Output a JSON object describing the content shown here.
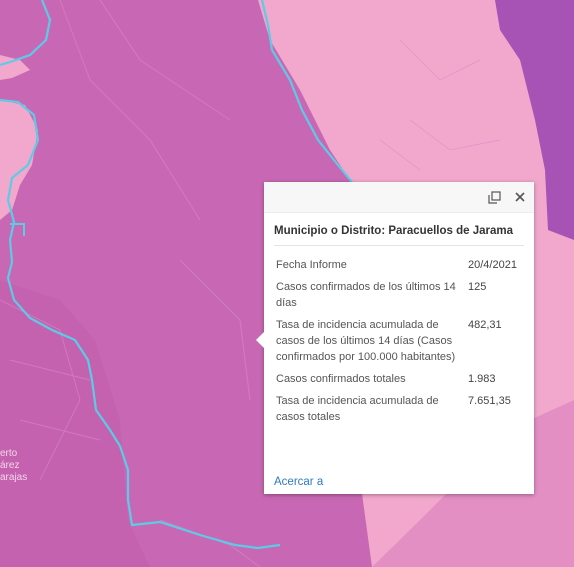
{
  "map": {
    "place_label_lines": [
      "erto",
      "árez",
      "arajas"
    ],
    "colors": {
      "dark_zone": "#c868b4",
      "light_zone": "#f2a8cc",
      "purple_zone": "#a753b5",
      "boundary": "#5ccbe6"
    }
  },
  "popup": {
    "title": "Municipio o Distrito: Paracuellos de Jarama",
    "maximize_icon": "maximize-icon",
    "close_icon": "close-icon",
    "rows": [
      {
        "label": "Fecha Informe",
        "value": "20/4/2021"
      },
      {
        "label": "Casos confirmados de los últimos 14 días",
        "value": "125"
      },
      {
        "label": "Tasa de incidencia acumulada de casos de los últimos 14 días (Casos confirmados por 100.000 habitantes)",
        "value": "482,31"
      },
      {
        "label": "Casos confirmados totales",
        "value": "1.983"
      },
      {
        "label": "Tasa de incidencia acumulada de casos totales",
        "value": "7.651,35"
      }
    ],
    "zoom_link": "Acercar a"
  }
}
